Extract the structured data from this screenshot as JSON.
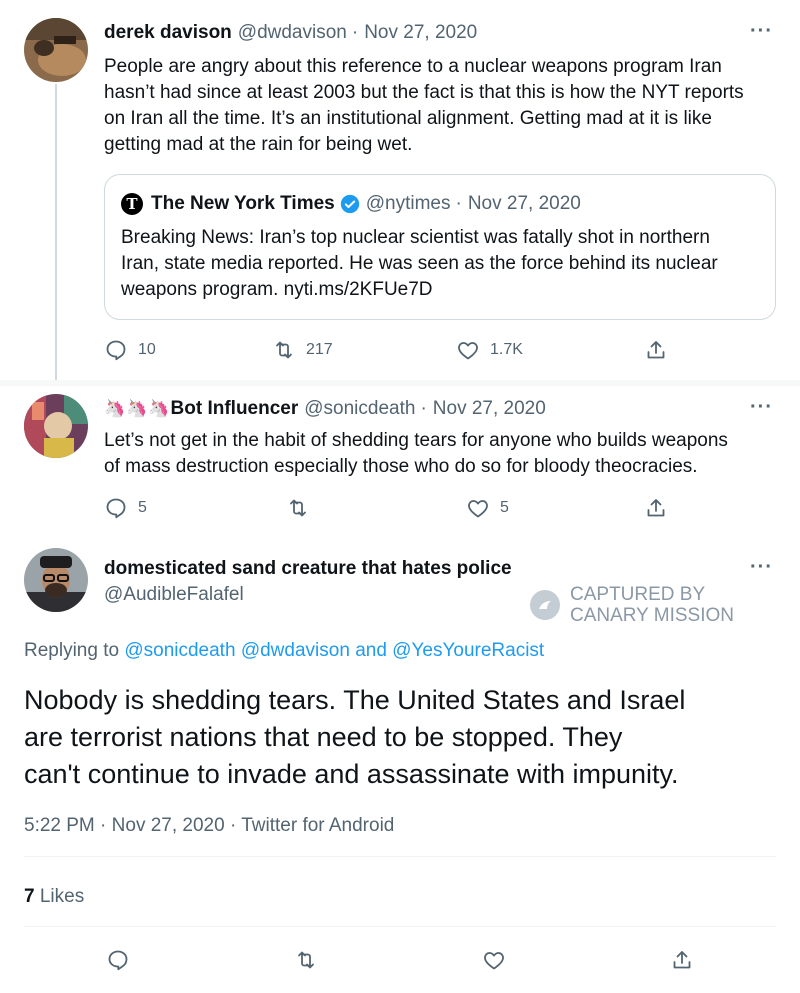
{
  "tweet1": {
    "name": "derek davison",
    "handle": "@dwdavison",
    "date": "Nov 27, 2020",
    "text_lines": [
      "People are angry about this reference to a nuclear weapons program Iran",
      "hasn’t had since at least 2003 but the fact is that this is how the NYT reports",
      "on Iran all the time. It’s an institutional alignment. Getting mad at it is like",
      "getting mad at the rain for being wet."
    ],
    "quote": {
      "name": "The New York Times",
      "handle": "@nytimes",
      "date": "Nov 27, 2020",
      "text_lines": [
        "Breaking News: Iran’s top nuclear scientist was fatally shot in northern",
        "Iran, state media reported. He was seen as the force behind its nuclear",
        "weapons program. nyti.ms/2KFUe7D"
      ]
    },
    "replies": "10",
    "retweets": "217",
    "likes": "1.7K"
  },
  "tweet2": {
    "name": "Bot Influencer",
    "handle": "@sonicdeath",
    "date": "Nov 27, 2020",
    "text_lines": [
      "Let’s not get in the habit of shedding tears for anyone who builds weapons",
      "of mass destruction especially those who do so for bloody theocracies."
    ],
    "replies": "5",
    "likes": "5"
  },
  "tweet3": {
    "name": "domesticated sand creature that hates police",
    "handle": "@AudibleFalafel",
    "replying_prefix": "Replying to",
    "replying_users": [
      "@sonicdeath",
      "@dwdavison",
      "@YesYoureRacist"
    ],
    "replying_and": "and",
    "text_lines": [
      "Nobody is shedding tears. The United States and Israel",
      "are terrorist nations that need to be stopped. They",
      "can't continue to invade and assassinate with impunity."
    ],
    "time": "5:22 PM",
    "date": "Nov 27, 2020",
    "source": "Twitter for Android",
    "like_count": "7",
    "like_label": "Likes"
  },
  "watermark": {
    "line1": "CAPTURED BY",
    "line2": "CANARY MISSION"
  },
  "separator": "·",
  "more_label": "···"
}
